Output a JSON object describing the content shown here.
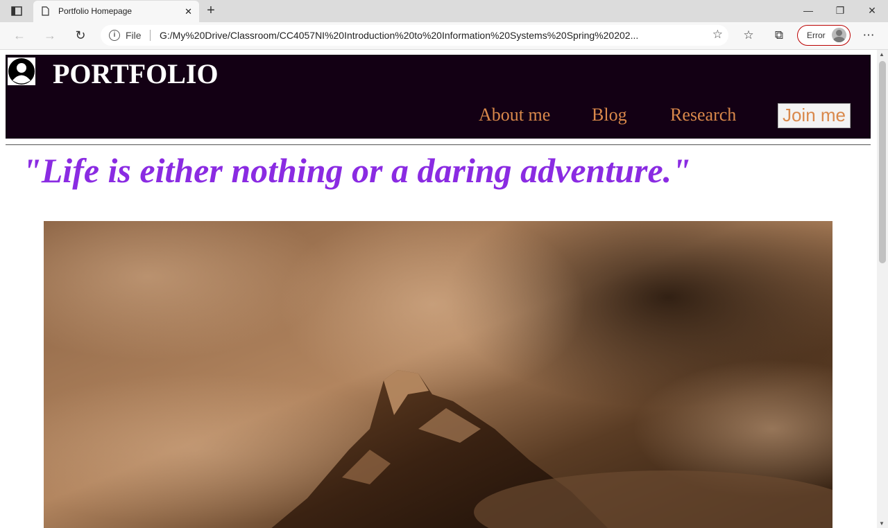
{
  "browser": {
    "tab_title": "Portfolio Homepage",
    "tab_close": "✕",
    "new_tab": "+",
    "window": {
      "minimize": "—",
      "restore": "❐",
      "close": "✕"
    },
    "nav": {
      "back": "←",
      "forward": "→",
      "reload": "↻"
    },
    "address": {
      "info": "i",
      "scheme_label": "File",
      "url": "G:/My%20Drive/Classroom/CC4057NI%20Introduction%20to%20Information%20Systems%20Spring%20202..."
    },
    "profile_label": "Error",
    "more": "⋯"
  },
  "page": {
    "brand": "PORTFOLIO",
    "nav_items": [
      "About me",
      "Blog",
      "Research"
    ],
    "join_button": "Join me",
    "quote": "\"Life is either nothing or a daring adventure.\""
  },
  "colors": {
    "header_bg": "#130014",
    "nav_text": "#d9884b",
    "quote_text": "#8a2be2"
  }
}
